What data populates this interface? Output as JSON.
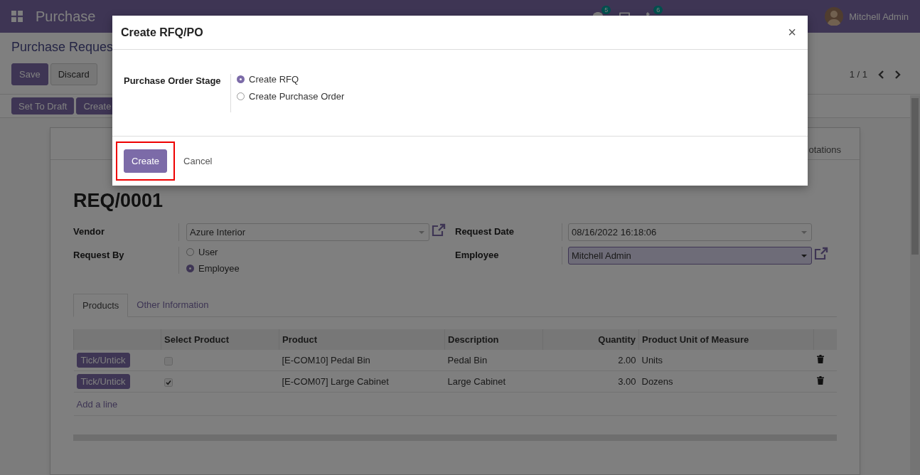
{
  "navbar": {
    "app_title": "Purchase",
    "chat_count": "5",
    "activity_count": "6",
    "user": "Mitchell Admin"
  },
  "breadcrumb": "Purchase Reques",
  "control_buttons": [
    {
      "label": "Save",
      "kind": "primary"
    },
    {
      "label": "Discard",
      "kind": "secondary"
    }
  ],
  "pager": "1 / 1",
  "status_buttons": [
    "Set To Draft",
    "Create"
  ],
  "form": {
    "smart_button": "otations",
    "name": "REQ/0001",
    "left_fields": [
      {
        "label": "Vendor",
        "kind": "select",
        "value": "Azure Interior",
        "focused": false,
        "link": true
      },
      {
        "label": "Request By",
        "kind": "radio",
        "options": [
          {
            "label": "User",
            "selected": false
          },
          {
            "label": "Employee",
            "selected": true
          }
        ]
      }
    ],
    "right_fields": [
      {
        "label": "Request Date",
        "kind": "select",
        "value": "08/16/2022 16:18:06",
        "focused": false,
        "link": false
      },
      {
        "label": "Employee",
        "kind": "select",
        "value": "Mitchell Admin",
        "focused": true,
        "link": true
      }
    ],
    "tabs": [
      {
        "label": "Products",
        "selected": true
      },
      {
        "label": "Other Information",
        "selected": false
      }
    ],
    "table": {
      "columns": [
        "Select Product",
        "Product",
        "Description",
        "Quantity",
        "Product Unit of Measure"
      ],
      "rows": [
        {
          "action": "Tick/Untick",
          "checked": false,
          "product": "[E-COM10] Pedal Bin",
          "description": "Pedal Bin",
          "quantity": "2.00",
          "uom": "Units"
        },
        {
          "action": "Tick/Untick",
          "checked": true,
          "product": "[E-COM07] Large Cabinet",
          "description": "Large Cabinet",
          "quantity": "3.00",
          "uom": "Dozens"
        }
      ],
      "add_line": "Add a line"
    }
  },
  "dialog": {
    "title": "Create RFQ/PO",
    "close": "×",
    "field_label": "Purchase Order Stage",
    "options": [
      {
        "label": "Create RFQ",
        "selected": true
      },
      {
        "label": "Create Purchase Order",
        "selected": false
      }
    ],
    "buttons": [
      {
        "label": "Create",
        "kind": "primary",
        "highlighted": true
      },
      {
        "label": "Cancel",
        "kind": "link",
        "highlighted": false
      }
    ]
  }
}
